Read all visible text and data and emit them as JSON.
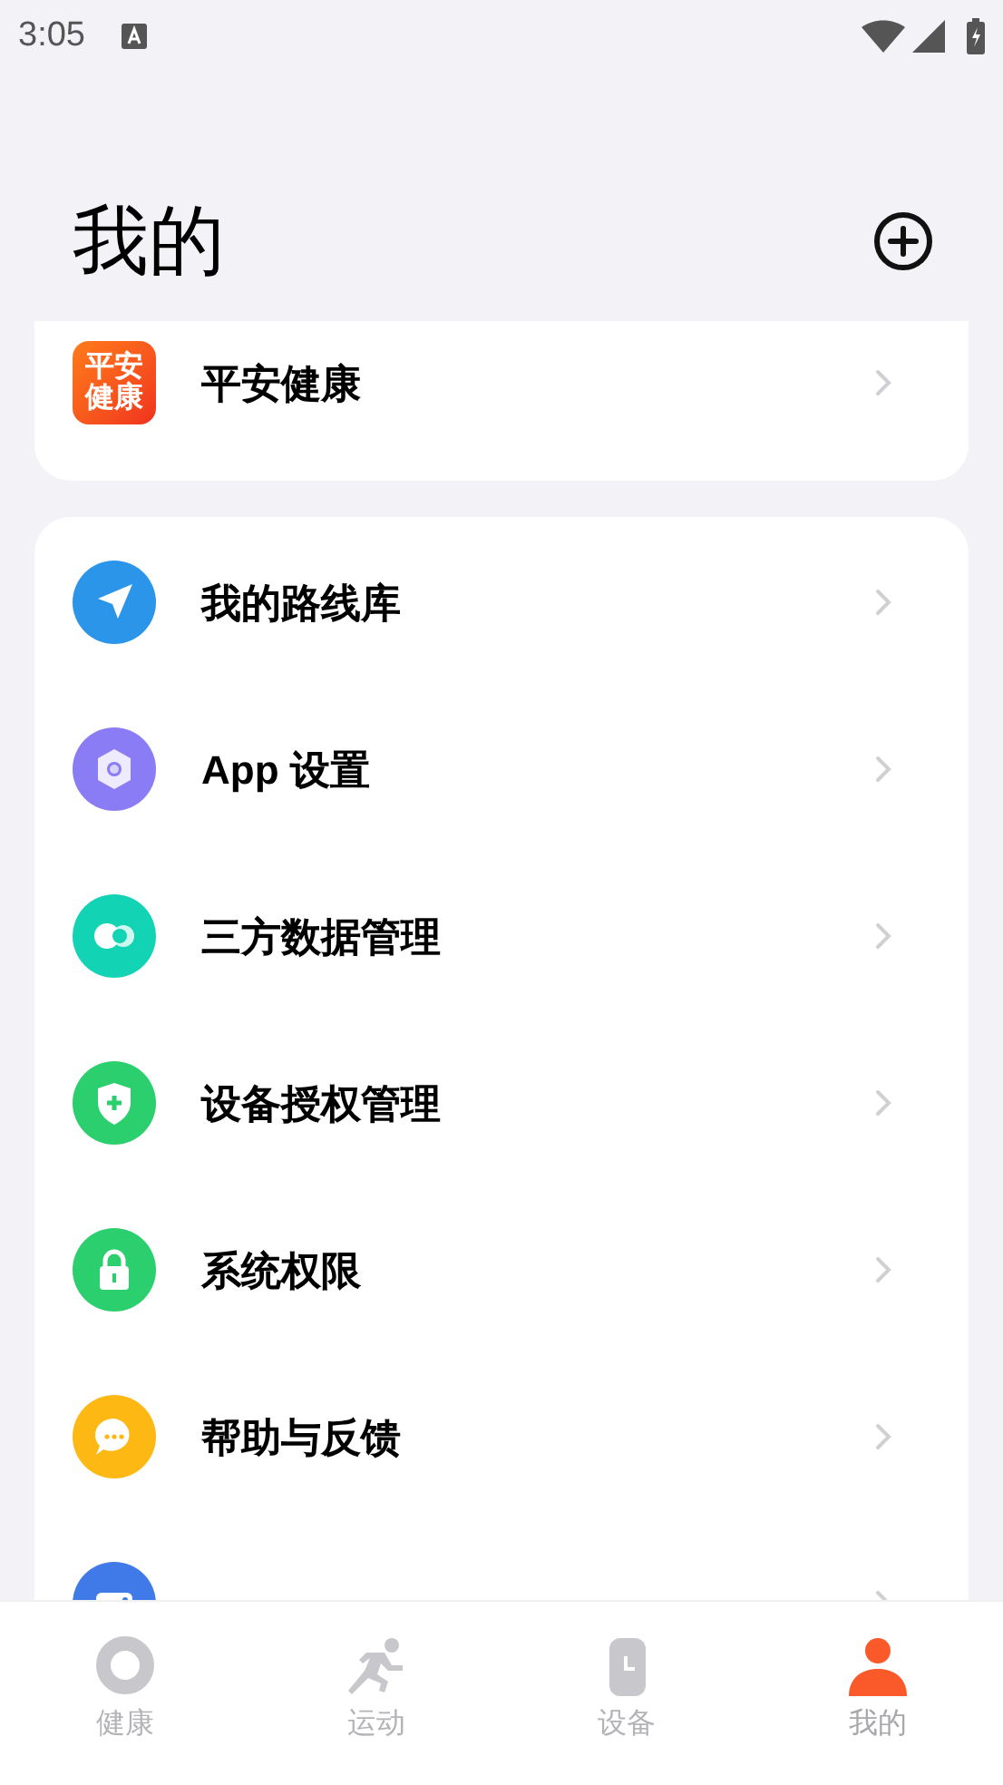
{
  "status_bar": {
    "time": "3:05"
  },
  "header": {
    "title": "我的"
  },
  "partner_card": {
    "logo_lines": [
      "平安",
      "健康"
    ],
    "label": "平安健康"
  },
  "menu": [
    {
      "kind": "route",
      "label": "我的路线库"
    },
    {
      "kind": "settings",
      "label": "App 设置"
    },
    {
      "kind": "data",
      "label": "三方数据管理"
    },
    {
      "kind": "shield",
      "label": "设备授权管理"
    },
    {
      "kind": "lock",
      "label": "系统权限"
    },
    {
      "kind": "chat",
      "label": "帮助与反馈"
    },
    {
      "kind": "share"
    }
  ],
  "tabs": [
    {
      "kind": "health",
      "label": "健康",
      "selected": false
    },
    {
      "kind": "sport",
      "label": "运动",
      "selected": false
    },
    {
      "kind": "device",
      "label": "设备",
      "selected": false
    },
    {
      "kind": "me",
      "label": "我的",
      "selected": true
    }
  ]
}
